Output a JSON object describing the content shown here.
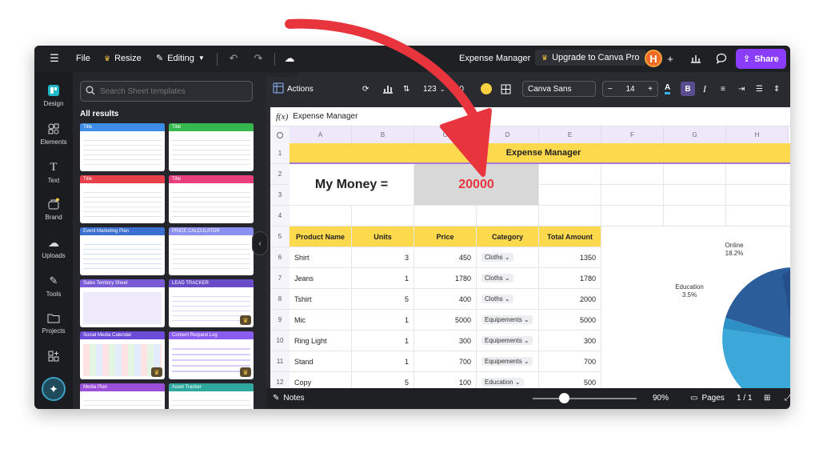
{
  "topbar": {
    "file": "File",
    "resize": "Resize",
    "editing": "Editing",
    "doc_title": "Expense Manager",
    "upgrade": "Upgrade to Canva Pro",
    "avatar_initial": "H",
    "share": "Share"
  },
  "rail": [
    {
      "label": "Design",
      "icon": "design-icon"
    },
    {
      "label": "Elements",
      "icon": "elements-icon"
    },
    {
      "label": "Text",
      "icon": "text-icon"
    },
    {
      "label": "Brand",
      "icon": "brand-icon"
    },
    {
      "label": "Uploads",
      "icon": "uploads-icon"
    },
    {
      "label": "Tools",
      "icon": "tools-icon"
    },
    {
      "label": "Projects",
      "icon": "projects-icon"
    }
  ],
  "panel": {
    "search_placeholder": "Search Sheet templates",
    "all_results": "All results",
    "templates": [
      {
        "title": "Title",
        "color": "#3b8de8"
      },
      {
        "title": "Title",
        "color": "#36b84f"
      },
      {
        "title": "Title",
        "color": "#e8404a"
      },
      {
        "title": "Title",
        "color": "#e8407a"
      },
      {
        "title": "Event Marketing Plan",
        "color": "#3b6fd0"
      },
      {
        "title": "PRICE CALCULATOR",
        "color": "#8b8ff0"
      },
      {
        "title": "Sales Territory Sheet",
        "color": "#7a5bd6"
      },
      {
        "title": "LEAD TRACKER",
        "color": "#6a4cc9"
      },
      {
        "title": "Social Media Calendar",
        "color": "#6c4bd8"
      },
      {
        "title": "Content Request Log",
        "color": "#8b5cf0"
      },
      {
        "title": "Media Plan",
        "color": "#9b4fd8"
      },
      {
        "title": "Asset Tracker",
        "color": "#2fa9a0"
      }
    ]
  },
  "toolbar": {
    "actions": "Actions",
    "number_format": "123",
    "decimal": ".00",
    "font": "Canva Sans",
    "font_size": "14",
    "bold": "B",
    "italic": "I"
  },
  "sheet": {
    "formula_label": "f(x)",
    "formula_value": "Expense Manager",
    "columns": [
      "A",
      "B",
      "C",
      "D",
      "E",
      "F",
      "G",
      "H"
    ],
    "rows": [
      "1",
      "2",
      "3",
      "4",
      "5",
      "6",
      "7",
      "8",
      "9",
      "10",
      "11",
      "12"
    ],
    "title": "Expense Manager",
    "money_label": "My Money =",
    "money_value": "20000",
    "headers": [
      "Product Name",
      "Units",
      "Price",
      "Category",
      "Total Amount"
    ],
    "data": [
      {
        "name": "Shirt",
        "units": "3",
        "price": "450",
        "category": "Cloths",
        "total": "1350"
      },
      {
        "name": "Jeans",
        "units": "1",
        "price": "1780",
        "category": "Cloths",
        "total": "1780"
      },
      {
        "name": "Tshirt",
        "units": "5",
        "price": "400",
        "category": "Cloths",
        "total": "2000"
      },
      {
        "name": "Mic",
        "units": "1",
        "price": "5000",
        "category": "Equipements",
        "total": "5000"
      },
      {
        "name": "Ring Light",
        "units": "1",
        "price": "300",
        "category": "Equipements",
        "total": "300"
      },
      {
        "name": "Stand",
        "units": "1",
        "price": "700",
        "category": "Equipements",
        "total": "700"
      },
      {
        "name": "Copy",
        "units": "5",
        "price": "100",
        "category": "Education",
        "total": "500"
      }
    ]
  },
  "pie": {
    "labels": [
      {
        "name": "Online",
        "pct": "18.2%"
      },
      {
        "name": "Education",
        "pct": "3.5%"
      }
    ],
    "colors": [
      "#2b5d9b",
      "#3b9bd6",
      "#5fd0e0",
      "#2e8fc6"
    ]
  },
  "bottombar": {
    "notes": "Notes",
    "zoom": "90%",
    "pages": "Pages",
    "page_count": "1 / 1",
    "help": "?"
  },
  "colors": {
    "accent_purple": "#8b3dff",
    "arrow_red": "#e8343c",
    "header_yellow": "#fdd94d"
  }
}
